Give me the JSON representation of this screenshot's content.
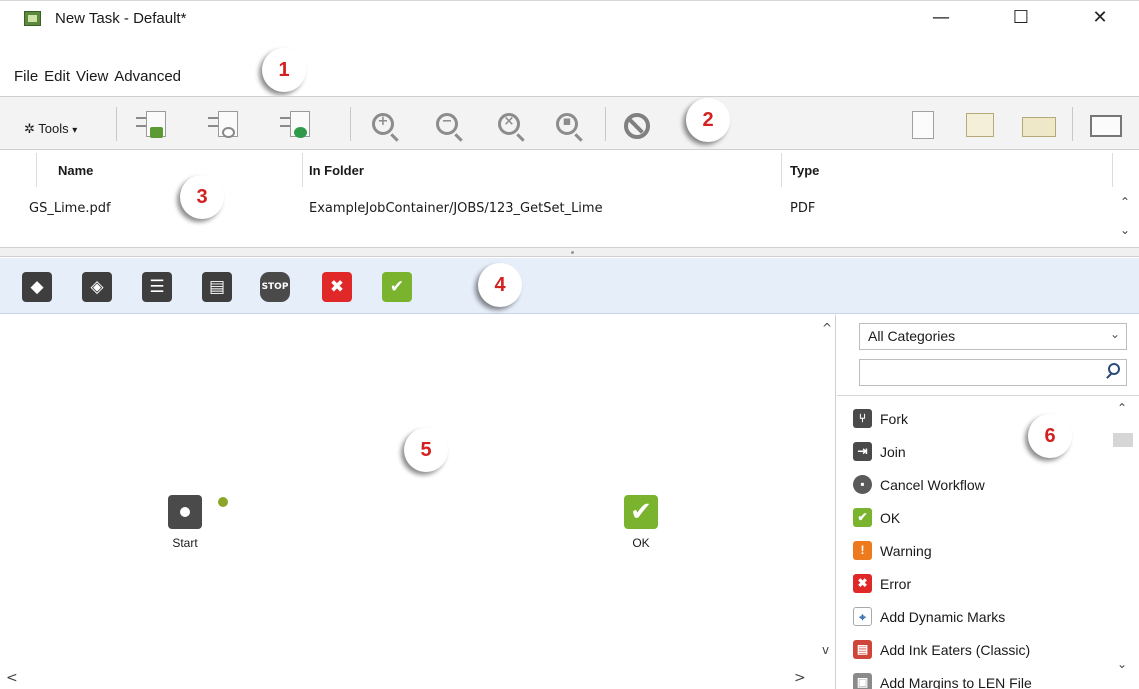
{
  "window": {
    "title": "New Task - Default*",
    "minimize_glyph": "—",
    "maximize_glyph": "☐",
    "close_glyph": "✕"
  },
  "menu": [
    "File",
    "Edit",
    "View",
    "Advanced"
  ],
  "badges": [
    "1",
    "2",
    "3",
    "4",
    "5",
    "6"
  ],
  "toolbar": {
    "tools_label": "Tools",
    "tools_caret": "▾",
    "tools_icon": "✲",
    "file_icons": [
      "add-files-icon",
      "view-file-icon",
      "launch-file-icon"
    ],
    "zoom_icons": [
      "zoom-in-icon",
      "zoom-out-icon",
      "zoom-reset-icon",
      "zoom-fit-icon"
    ],
    "zoom_symbols": [
      "+",
      "−",
      "×",
      "▪"
    ],
    "right_icons": [
      "page-icon",
      "sheet-icon",
      "layout-icon",
      "panel-icon"
    ]
  },
  "files": {
    "columns": [
      "Name",
      "In Folder",
      "Type"
    ],
    "rows": [
      {
        "name": "GS_Lime.pdf",
        "folder": "ExampleJobContainer/JOBS/123_GetSet_Lime",
        "type": "PDF"
      }
    ]
  },
  "checkpoints": {
    "icons": [
      "tag-icon",
      "tag-select-icon",
      "list-icon",
      "columns-icon",
      "stop-icon",
      "error-icon",
      "ok-icon"
    ],
    "stop_label": "STOP",
    "error_glyph": "✖",
    "ok_glyph": "✔"
  },
  "canvas": {
    "nodes": [
      {
        "label": "Start"
      },
      {
        "label": "OK"
      }
    ],
    "scroll_up": "^",
    "scroll_down": "v",
    "scroll_left": "<",
    "scroll_right": ">"
  },
  "steps_panel": {
    "category": "All Categories",
    "search_value": "",
    "steps": [
      {
        "label": "Fork",
        "icon": "fork-icon",
        "glyph": "⑂",
        "color": "#4a4a4a"
      },
      {
        "label": "Join",
        "icon": "join-icon",
        "glyph": "⇥",
        "color": "#4a4a4a"
      },
      {
        "label": "Cancel Workflow",
        "icon": "stop-icon",
        "glyph": "▪",
        "color": "#5a5a5a"
      },
      {
        "label": "OK",
        "icon": "ok-icon",
        "glyph": "✔",
        "color": "#7ab32e"
      },
      {
        "label": "Warning",
        "icon": "warning-icon",
        "glyph": "!",
        "color": "#ee7a1e"
      },
      {
        "label": "Error",
        "icon": "error-icon",
        "glyph": "✖",
        "color": "#e02828"
      },
      {
        "label": "Add Dynamic Marks",
        "icon": "dynamic-marks-icon",
        "glyph": "⌖",
        "color": "#6d8fbf"
      },
      {
        "label": "Add Ink Eaters (Classic)",
        "icon": "ink-eaters-icon",
        "glyph": "▤",
        "color": "#d0453a"
      },
      {
        "label": "Add Margins to LEN File",
        "icon": "margins-icon",
        "glyph": "▣",
        "color": "#8a8a8a"
      }
    ]
  },
  "colors": {
    "accent_ok": "#7ab32e",
    "error_red": "#e02828",
    "badge_red": "#d32020",
    "checkpoint_bar": "#e6eefa"
  }
}
